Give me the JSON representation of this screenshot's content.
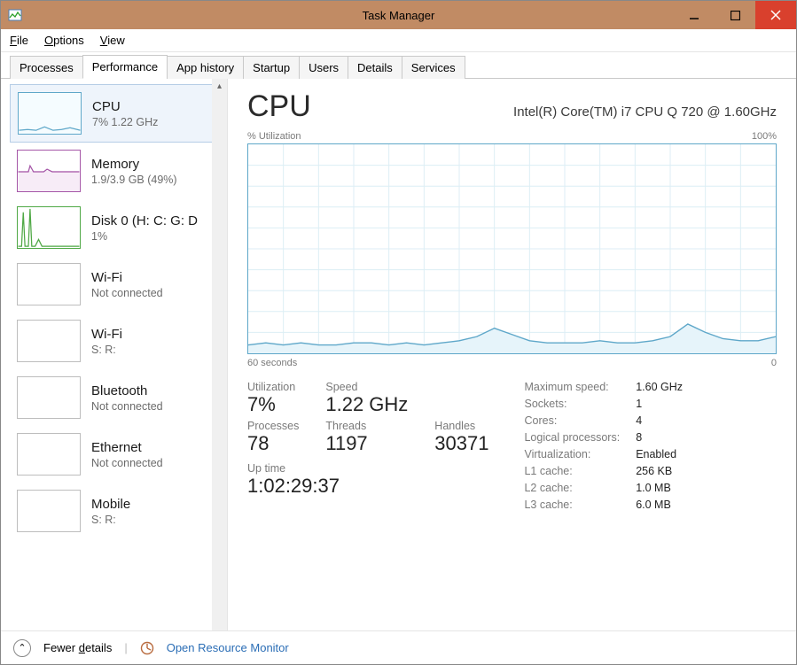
{
  "window": {
    "title": "Task Manager"
  },
  "menu": {
    "file": "File",
    "options": "Options",
    "view": "View",
    "file_u": "F",
    "options_u": "O",
    "view_u": "V"
  },
  "tabs": [
    "Processes",
    "Performance",
    "App history",
    "Startup",
    "Users",
    "Details",
    "Services"
  ],
  "active_tab": 1,
  "sidebar": [
    {
      "title": "CPU",
      "sub": "7% 1.22 GHz",
      "color": "#5ea7c9",
      "kind": "cpu",
      "selected": true
    },
    {
      "title": "Memory",
      "sub": "1.9/3.9 GB (49%)",
      "color": "#a556a7",
      "kind": "memory"
    },
    {
      "title": "Disk 0 (H: C: G: D",
      "sub": "1%",
      "color": "#4fa845",
      "kind": "disk"
    },
    {
      "title": "Wi-Fi",
      "sub": "Not connected",
      "color": "#bdbdbd",
      "kind": "net"
    },
    {
      "title": "Wi-Fi",
      "sub": "S: R:",
      "color": "#bdbdbd",
      "kind": "net"
    },
    {
      "title": "Bluetooth",
      "sub": "Not connected",
      "color": "#bdbdbd",
      "kind": "net"
    },
    {
      "title": "Ethernet",
      "sub": "Not connected",
      "color": "#bdbdbd",
      "kind": "net"
    },
    {
      "title": "Mobile",
      "sub": "S: R:",
      "color": "#bdbdbd",
      "kind": "net"
    }
  ],
  "main": {
    "title": "CPU",
    "model": "Intel(R) Core(TM) i7 CPU Q 720 @ 1.60GHz",
    "axis_top_left": "% Utilization",
    "axis_top_right": "100%",
    "axis_bot_left": "60 seconds",
    "axis_bot_right": "0"
  },
  "stats_left": {
    "utilization_label": "Utilization",
    "utilization": "7%",
    "speed_label": "Speed",
    "speed": "1.22 GHz",
    "processes_label": "Processes",
    "processes": "78",
    "threads_label": "Threads",
    "threads": "1197",
    "handles_label": "Handles",
    "handles": "30371",
    "uptime_label": "Up time",
    "uptime": "1:02:29:37"
  },
  "stats_right": {
    "max_speed_k": "Maximum speed:",
    "max_speed_v": "1.60 GHz",
    "sockets_k": "Sockets:",
    "sockets_v": "1",
    "cores_k": "Cores:",
    "cores_v": "4",
    "logical_k": "Logical processors:",
    "logical_v": "8",
    "virt_k": "Virtualization:",
    "virt_v": "Enabled",
    "l1_k": "L1 cache:",
    "l1_v": "256 KB",
    "l2_k": "L2 cache:",
    "l2_v": "1.0 MB",
    "l3_k": "L3 cache:",
    "l3_v": "6.0 MB"
  },
  "footer": {
    "fewer": "Fewer details",
    "resmon": "Open Resource Monitor"
  },
  "chart_data": {
    "type": "line",
    "title": "CPU % Utilization",
    "xlabel": "seconds ago",
    "ylabel": "% Utilization",
    "ylim": [
      0,
      100
    ],
    "xlim": [
      60,
      0
    ],
    "x": [
      60,
      58,
      56,
      54,
      52,
      50,
      48,
      46,
      44,
      42,
      40,
      38,
      36,
      34,
      32,
      30,
      28,
      26,
      24,
      22,
      20,
      18,
      16,
      14,
      12,
      10,
      8,
      6,
      4,
      2,
      0
    ],
    "values": [
      4,
      5,
      4,
      5,
      4,
      4,
      5,
      5,
      4,
      5,
      4,
      5,
      6,
      8,
      12,
      9,
      6,
      5,
      5,
      5,
      6,
      5,
      5,
      6,
      8,
      14,
      10,
      7,
      6,
      6,
      8
    ]
  }
}
